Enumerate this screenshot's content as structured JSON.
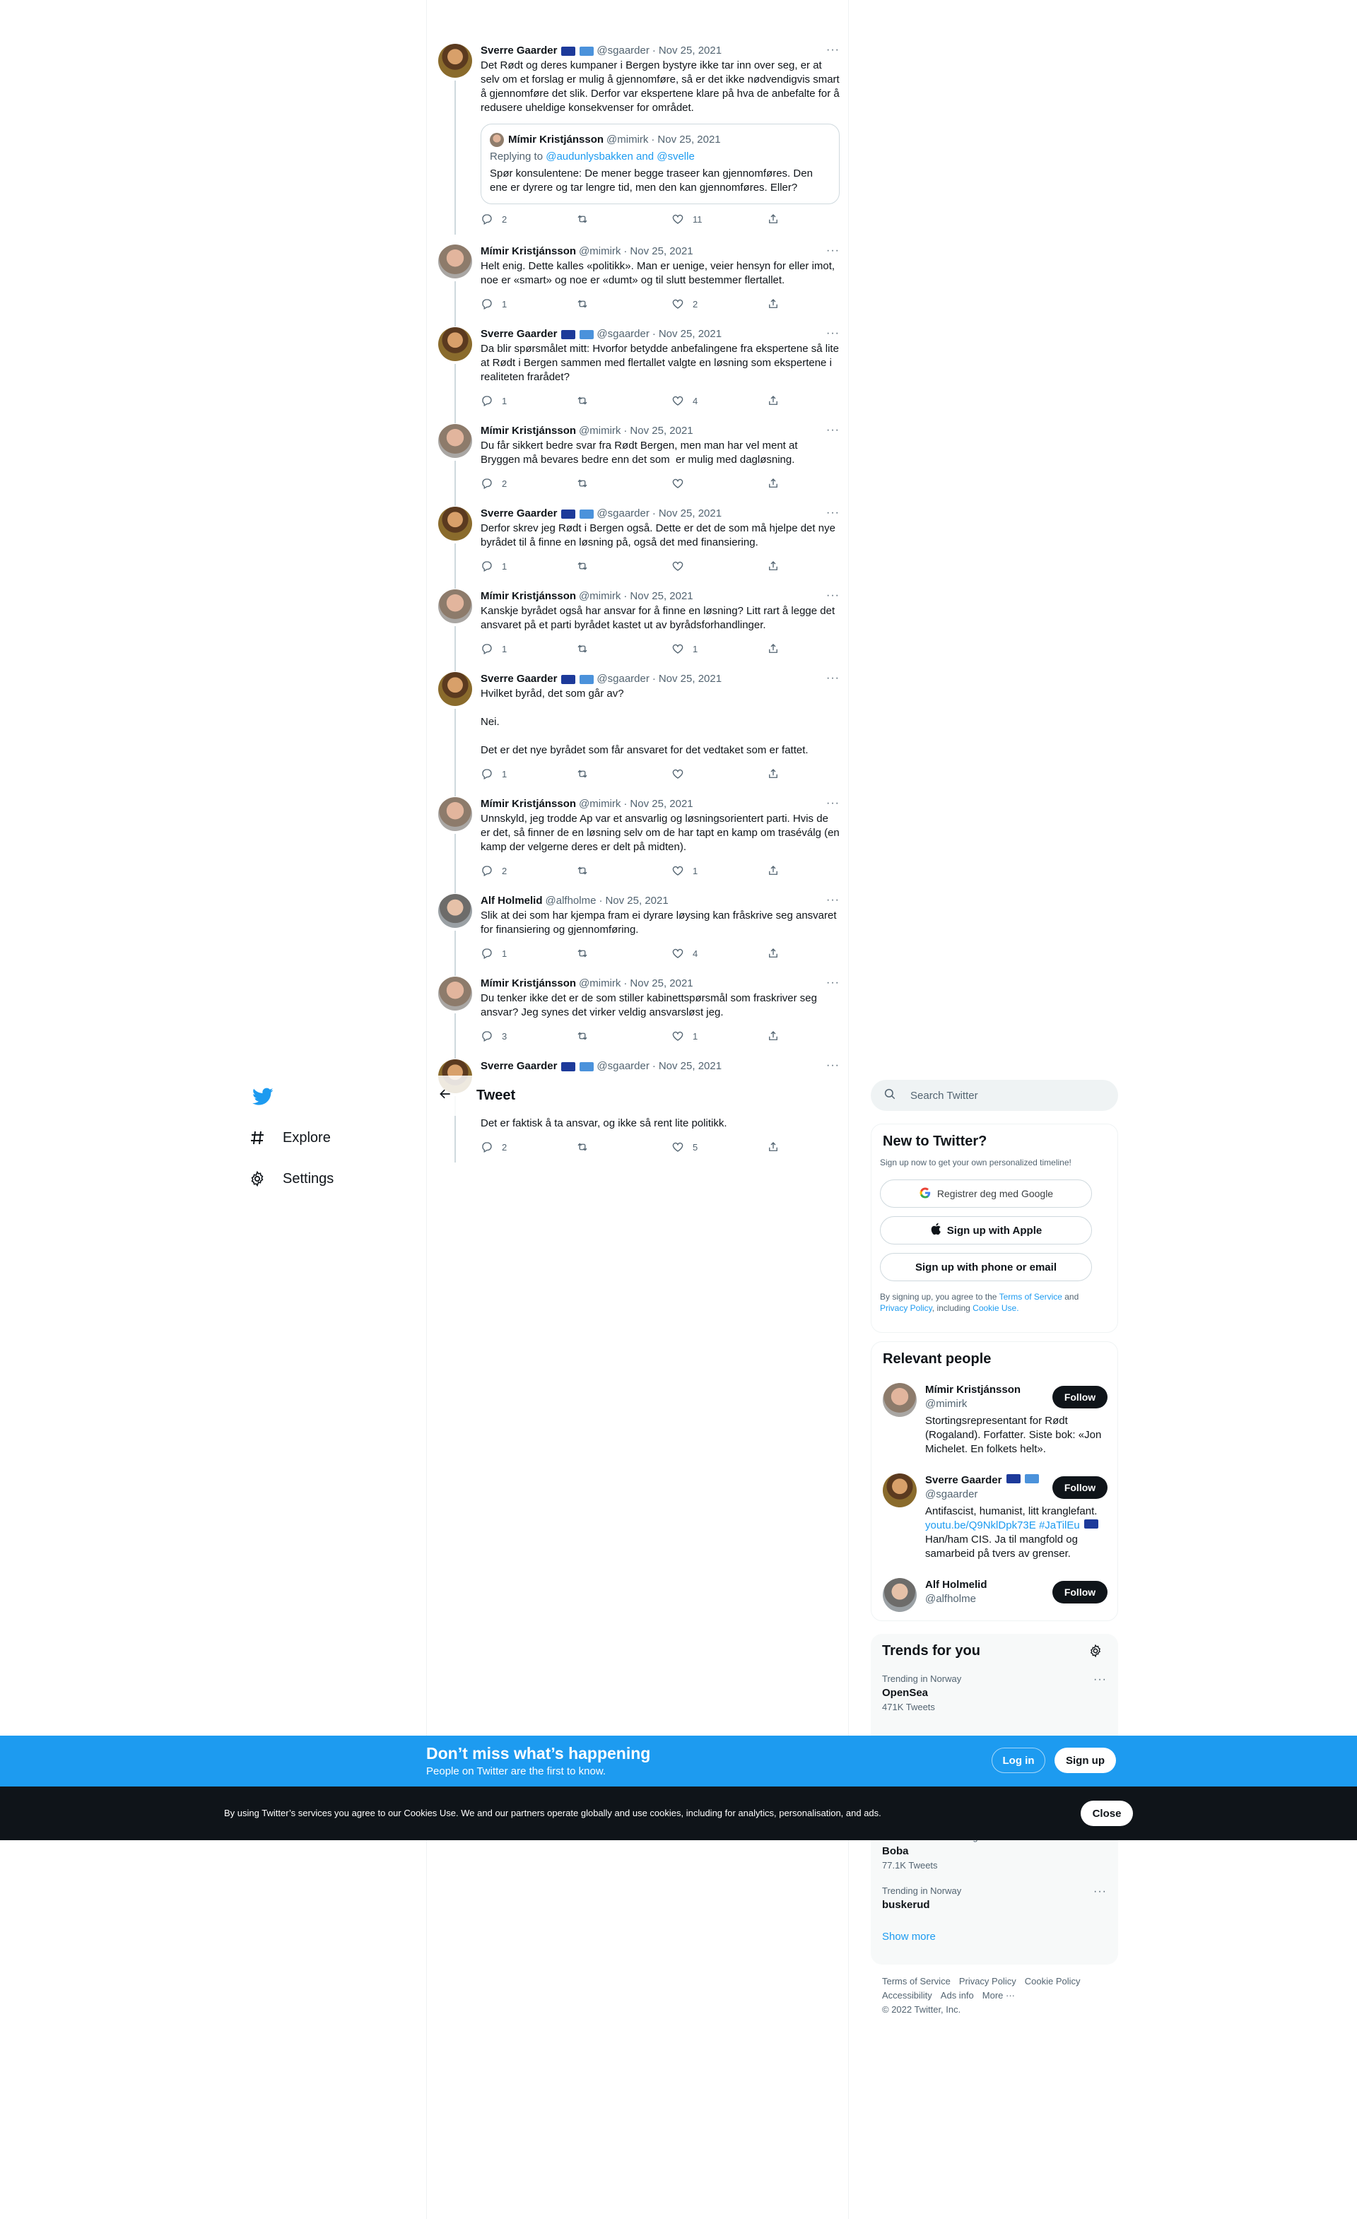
{
  "nav": {
    "explore_label": "Explore",
    "settings_label": "Settings"
  },
  "header": {
    "title": "Tweet"
  },
  "tweets": [
    {
      "name": "Sverre Gaarder",
      "handle": "@sgaarder",
      "date": "Nov 25, 2021",
      "text": "Det Rødt og deres kumpaner i Bergen bystyre ikke tar inn over seg, er at selv om et forslag er mulig å gjennomføre, så er det ikke nødvendigvis smart å gjennomføre det slik. Derfor var ekspertene klare på hva de anbefalte for å redusere uheldige konsekvenser for området.",
      "replies": "2",
      "retweets": "",
      "likes": "11",
      "quote": {
        "name": "Mímir Kristjánsson",
        "handle": "@mimirk",
        "date": "Nov 25, 2021",
        "replying_prefix": "Replying to ",
        "replying_to": "@audunlysbakken and @svelle",
        "text": "Spør konsulentene: De mener begge traseer kan gjennomføres. Den ene er dyrere og tar lengre tid, men den kan gjennomføres. Eller?"
      }
    },
    {
      "name": "Mímir Kristjánsson",
      "handle": "@mimirk",
      "date": "Nov 25, 2021",
      "text": "Helt enig. Dette kalles «politikk». Man er uenige, veier hensyn for eller imot, noe er «smart» og noe er «dumt» og til slutt bestemmer flertallet.",
      "replies": "1",
      "retweets": "",
      "likes": "2"
    },
    {
      "name": "Sverre Gaarder",
      "handle": "@sgaarder",
      "date": "Nov 25, 2021",
      "text": "Da blir spørsmålet mitt: Hvorfor betydde anbefalingene fra ekspertene så lite at Rødt i Bergen sammen med flertallet valgte en løsning som ekspertene i realiteten frarådet?",
      "replies": "1",
      "retweets": "",
      "likes": "4"
    },
    {
      "name": "Mímir Kristjánsson",
      "handle": "@mimirk",
      "date": "Nov 25, 2021",
      "text": "Du får sikkert bedre svar fra Rødt Bergen, men man har vel ment at Bryggen må bevares bedre enn det som  er mulig med dagløsning.",
      "replies": "2",
      "retweets": "",
      "likes": ""
    },
    {
      "name": "Sverre Gaarder",
      "handle": "@sgaarder",
      "date": "Nov 25, 2021",
      "text": "Derfor skrev jeg Rødt i Bergen også. Dette er det de som må hjelpe det nye byrådet til å finne en løsning på, også det med finansiering.",
      "replies": "1",
      "retweets": "",
      "likes": ""
    },
    {
      "name": "Mímir Kristjánsson",
      "handle": "@mimirk",
      "date": "Nov 25, 2021",
      "text": "Kanskje byrådet også har ansvar for å finne en løsning? Litt rart å legge det ansvaret på et parti byrådet kastet ut av byrådsforhandlinger.",
      "replies": "1",
      "retweets": "",
      "likes": "1"
    },
    {
      "name": "Sverre Gaarder",
      "handle": "@sgaarder",
      "date": "Nov 25, 2021",
      "text": "Hvilket byråd, det som går av?\n\nNei.\n\nDet er det nye byrådet som får ansvaret for det vedtaket som er fattet.",
      "replies": "1",
      "retweets": "",
      "likes": ""
    },
    {
      "name": "Mímir Kristjánsson",
      "handle": "@mimirk",
      "date": "Nov 25, 2021",
      "text": "Unnskyld, jeg trodde Ap var et ansvarlig og løsningsorientert parti. Hvis de er det, så finner de en løsning selv om de har tapt en kamp om traséválg (en kamp der velgerne deres er delt på midten).",
      "replies": "2",
      "retweets": "",
      "likes": "1"
    },
    {
      "name": "Alf Holmelid",
      "handle": "@alfholme",
      "date": "Nov 25, 2021",
      "text": "Slik at dei som har kjempa fram ei dyrare løysing kan fråskrive seg ansvaret for finansiering og gjennomføring.",
      "replies": "1",
      "retweets": "",
      "likes": "4"
    },
    {
      "name": "Mímir Kristjánsson",
      "handle": "@mimirk",
      "date": "Nov 25, 2021",
      "text": "Du tenker ikke det er de som stiller kabinettspørsmål som fraskriver seg ansvar? Jeg synes det virker veldig ansvarsløst jeg.",
      "replies": "3",
      "retweets": "",
      "likes": "1"
    },
    {
      "name": "Sverre Gaarder",
      "handle": "@sgaarder",
      "date": "Nov 25, 2021",
      "text": "Det er faktisk å ta ansvar, og ikke så rent lite politikk.",
      "replies": "2",
      "retweets": "",
      "likes": "5"
    }
  ],
  "search": {
    "placeholder": "Search Twitter"
  },
  "new_to_twitter": {
    "title": "New to Twitter?",
    "subtitle": "Sign up now to get your own personalized timeline!",
    "google_btn": "Registrer deg med Google",
    "apple_btn": "Sign up with Apple",
    "phone_btn": "Sign up with phone or email",
    "terms_prefix": "By signing up, you agree to the ",
    "terms_link": "Terms of Service",
    "terms_and": " and ",
    "privacy_link": "Privacy Policy",
    "including": ", including ",
    "cookie_link": "Cookie Use."
  },
  "relevant_people": {
    "title": "Relevant people",
    "follow_label": "Follow",
    "people": [
      {
        "name": "Mímir Kristjánsson",
        "handle": "@mimirk",
        "bio": "Stortingsrepresentant for Rødt (Rogaland). Forfatter. Siste bok: «Jon Michelet. En folkets helt»."
      },
      {
        "name": "Sverre Gaarder",
        "handle": "@sgaarder",
        "bio": "Antifascist, humanist, litt kranglefant.",
        "bio_link": "youtu.be/Q9NklDpk73E",
        "bio_tag": "#JaTilEu",
        "bio_rest": "Han/ham CIS. Ja til mangfold og samarbeid på tvers av grenser."
      },
      {
        "name": "Alf Holmelid",
        "handle": "@alfholme",
        "bio": ""
      }
    ]
  },
  "trends": {
    "title": "Trends for you",
    "items": [
      {
        "meta": "Trending in Norway",
        "name": "OpenSea",
        "count": "471K Tweets"
      },
      {
        "meta": "Movies & TV · Trending",
        "name": "Boba",
        "count": "77.1K Tweets"
      },
      {
        "meta": "Trending in Norway",
        "name": "buskerud",
        "count": ""
      }
    ],
    "show_more": "Show more"
  },
  "footer": {
    "links": [
      "Terms of Service",
      "Privacy Policy",
      "Cookie Policy",
      "Accessibility",
      "Ads info",
      "More ···"
    ],
    "copyright": "© 2022 Twitter, Inc."
  },
  "banner": {
    "title": "Don’t miss what’s happening",
    "subtitle": "People on Twitter are the first to know.",
    "login": "Log in",
    "signup": "Sign up"
  },
  "cookie": {
    "text": "By using Twitter’s services you agree to our Cookies Use. We and our partners operate globally and use cookies, including for analytics, personalisation, and ads.",
    "close": "Close"
  },
  "colors": {
    "accent": "#1d9bf0",
    "text": "#0f1419",
    "secondary": "#536471",
    "border": "#eff3f4"
  }
}
